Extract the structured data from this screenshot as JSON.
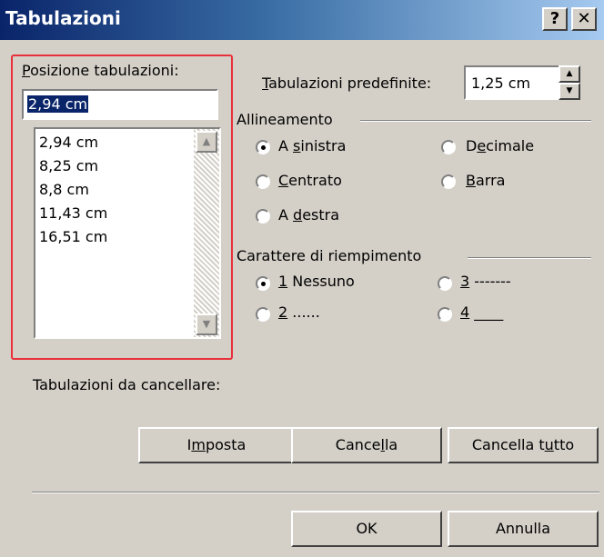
{
  "window": {
    "title": "Tabulazioni",
    "help_label": "?",
    "close_label": "✕"
  },
  "position": {
    "label": "Posizione tabulazioni:",
    "label_accel": "P",
    "label_rest": "osizione tabulazioni:",
    "value": "2,94 cm",
    "items": [
      "2,94 cm",
      "8,25 cm",
      "8,8 cm",
      "11,43 cm",
      "16,51 cm"
    ]
  },
  "default_tabs": {
    "label_accel": "T",
    "label_rest": "abulazioni predefinite:",
    "value": "1,25 cm"
  },
  "alignment": {
    "label": "Allineamento",
    "options": [
      {
        "pre": "A ",
        "accel": "s",
        "post": "inistra",
        "checked": true
      },
      {
        "pre": "",
        "accel": "C",
        "post": "entrato",
        "checked": false
      },
      {
        "pre": "A ",
        "accel": "d",
        "post": "estra",
        "checked": false
      },
      {
        "pre": "D",
        "accel": "e",
        "post": "cimale",
        "checked": false
      },
      {
        "pre": "",
        "accel": "B",
        "post": "arra",
        "checked": false
      }
    ]
  },
  "leader": {
    "label": "Carattere di riempimento",
    "options": [
      {
        "accel": "1",
        "post": " Nessuno",
        "checked": true
      },
      {
        "accel": "2",
        "post": " ......",
        "checked": false
      },
      {
        "accel": "3",
        "post": " -------",
        "checked": false
      },
      {
        "accel": "4",
        "post": " ____",
        "checked": false
      }
    ]
  },
  "to_clear_label": "Tabulazioni da cancellare:",
  "buttons": {
    "set": {
      "pre": "I",
      "accel": "m",
      "post": "posta"
    },
    "clear": {
      "pre": "Cance",
      "accel": "l",
      "post": "la"
    },
    "clear_all": {
      "pre": "Cancella t",
      "accel": "u",
      "post": "tto"
    },
    "ok": "OK",
    "cancel": "Annulla"
  },
  "colors": {
    "title_start": "#0a246a",
    "title_end": "#a6caf0",
    "face": "#d4d0c8",
    "highlight": "#e8303a"
  }
}
